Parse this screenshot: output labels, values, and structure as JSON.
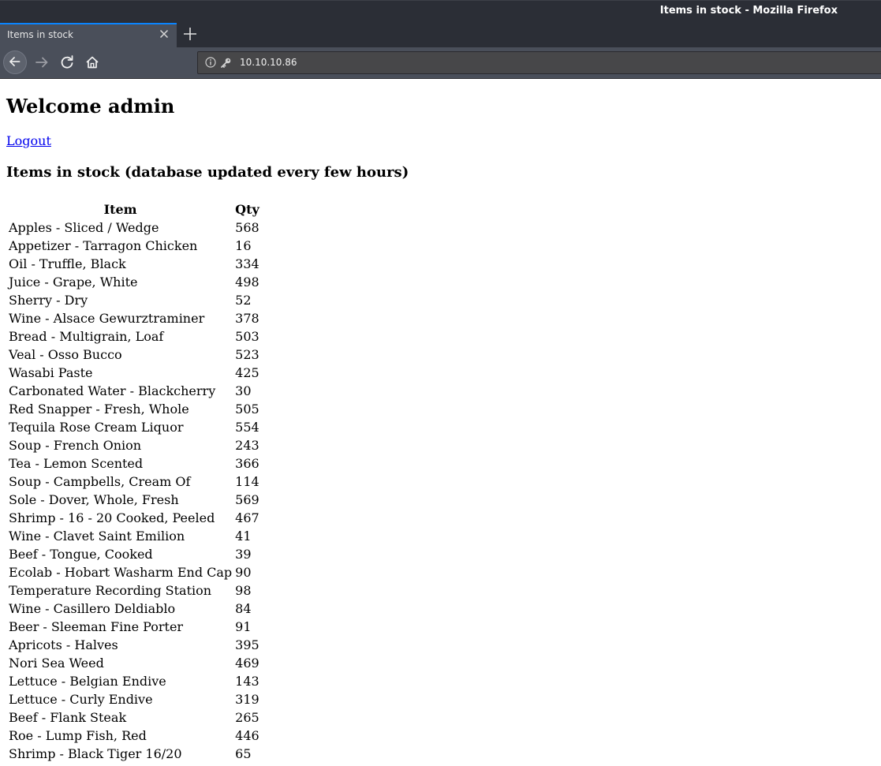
{
  "window": {
    "title": "Items in stock - Mozilla Firefox"
  },
  "tab": {
    "label": "Items in stock"
  },
  "urlbar": {
    "url": "10.10.10.86"
  },
  "page": {
    "heading": "Welcome admin",
    "logout_label": "Logout",
    "subheading": "Items in stock (database updated every few hours)",
    "columns": [
      "Item",
      "Qty"
    ],
    "rows": [
      {
        "item": "Apples - Sliced / Wedge",
        "qty": "568"
      },
      {
        "item": "Appetizer - Tarragon Chicken",
        "qty": "16"
      },
      {
        "item": "Oil - Truffle, Black",
        "qty": "334"
      },
      {
        "item": "Juice - Grape, White",
        "qty": "498"
      },
      {
        "item": "Sherry - Dry",
        "qty": "52"
      },
      {
        "item": "Wine - Alsace Gewurztraminer",
        "qty": "378"
      },
      {
        "item": "Bread - Multigrain, Loaf",
        "qty": "503"
      },
      {
        "item": "Veal - Osso Bucco",
        "qty": "523"
      },
      {
        "item": "Wasabi Paste",
        "qty": "425"
      },
      {
        "item": "Carbonated Water - Blackcherry",
        "qty": "30"
      },
      {
        "item": "Red Snapper - Fresh, Whole",
        "qty": "505"
      },
      {
        "item": "Tequila Rose Cream Liquor",
        "qty": "554"
      },
      {
        "item": "Soup - French Onion",
        "qty": "243"
      },
      {
        "item": "Tea - Lemon Scented",
        "qty": "366"
      },
      {
        "item": "Soup - Campbells, Cream Of",
        "qty": "114"
      },
      {
        "item": "Sole - Dover, Whole, Fresh",
        "qty": "569"
      },
      {
        "item": "Shrimp - 16 - 20 Cooked, Peeled",
        "qty": "467"
      },
      {
        "item": "Wine - Clavet Saint Emilion",
        "qty": "41"
      },
      {
        "item": "Beef - Tongue, Cooked",
        "qty": "39"
      },
      {
        "item": "Ecolab - Hobart Washarm End Cap",
        "qty": "90"
      },
      {
        "item": "Temperature Recording Station",
        "qty": "98"
      },
      {
        "item": "Wine - Casillero Deldiablo",
        "qty": "84"
      },
      {
        "item": "Beer - Sleeman Fine Porter",
        "qty": "91"
      },
      {
        "item": "Apricots - Halves",
        "qty": "395"
      },
      {
        "item": "Nori Sea Weed",
        "qty": "469"
      },
      {
        "item": "Lettuce - Belgian Endive",
        "qty": "143"
      },
      {
        "item": "Lettuce - Curly Endive",
        "qty": "319"
      },
      {
        "item": "Beef - Flank Steak",
        "qty": "265"
      },
      {
        "item": "Roe - Lump Fish, Red",
        "qty": "446"
      },
      {
        "item": "Shrimp - Black Tiger 16/20",
        "qty": "65"
      }
    ]
  },
  "icons": {
    "tab_close": "close-icon",
    "new_tab": "plus-icon",
    "back": "arrow-left-icon",
    "forward": "arrow-right-icon",
    "reload": "reload-icon",
    "home": "home-icon",
    "info": "info-icon",
    "key": "key-icon"
  },
  "colors": {
    "chrome_dark": "#2b2e36",
    "chrome_toolbar": "#4a4f5a",
    "tab_accent": "#0a84ff",
    "link": "#0000ee"
  }
}
